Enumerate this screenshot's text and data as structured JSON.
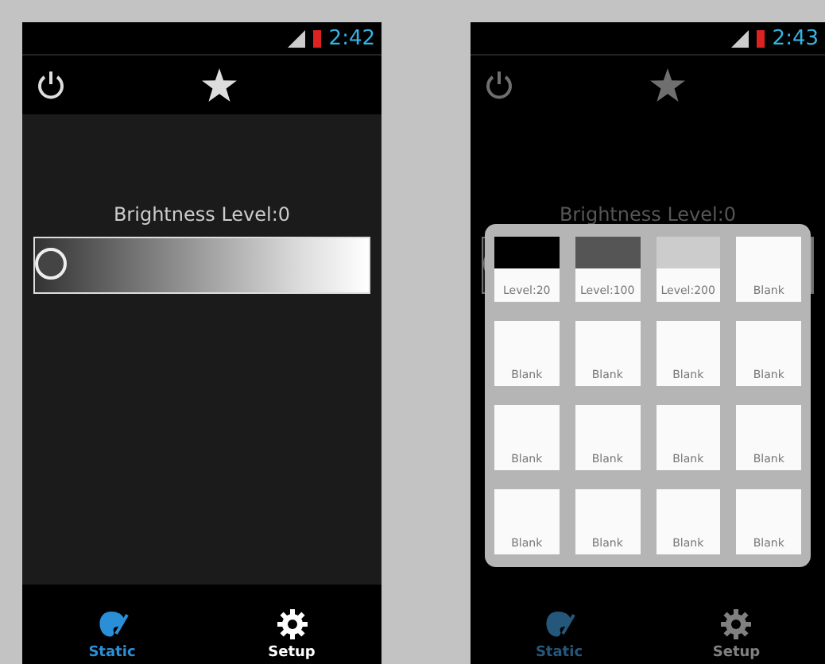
{
  "screens": [
    {
      "status_time": "2:42",
      "brightness_label": "Brightness Level:0",
      "slider": {
        "level": 0
      },
      "tabs": [
        {
          "label": "Static",
          "selected": true
        },
        {
          "label": "Setup",
          "selected": false
        }
      ]
    },
    {
      "status_time": "2:43",
      "brightness_label": "Brightness Level:0",
      "slider": {
        "level": 0
      },
      "tabs": [
        {
          "label": "Static",
          "selected": true
        },
        {
          "label": "Setup",
          "selected": false
        }
      ],
      "dialog": {
        "tiles": [
          {
            "kind": "swatch",
            "color": "#000000",
            "label": "Level:20"
          },
          {
            "kind": "swatch",
            "color": "#555555",
            "label": "Level:100"
          },
          {
            "kind": "swatch",
            "color": "#cccccc",
            "label": "Level:200"
          },
          {
            "kind": "blank",
            "label": "Blank"
          },
          {
            "kind": "blank",
            "label": "Blank"
          },
          {
            "kind": "blank",
            "label": "Blank"
          },
          {
            "kind": "blank",
            "label": "Blank"
          },
          {
            "kind": "blank",
            "label": "Blank"
          },
          {
            "kind": "blank",
            "label": "Blank"
          },
          {
            "kind": "blank",
            "label": "Blank"
          },
          {
            "kind": "blank",
            "label": "Blank"
          },
          {
            "kind": "blank",
            "label": "Blank"
          },
          {
            "kind": "blank",
            "label": "Blank"
          },
          {
            "kind": "blank",
            "label": "Blank"
          },
          {
            "kind": "blank",
            "label": "Blank"
          },
          {
            "kind": "blank",
            "label": "Blank"
          }
        ]
      }
    }
  ]
}
